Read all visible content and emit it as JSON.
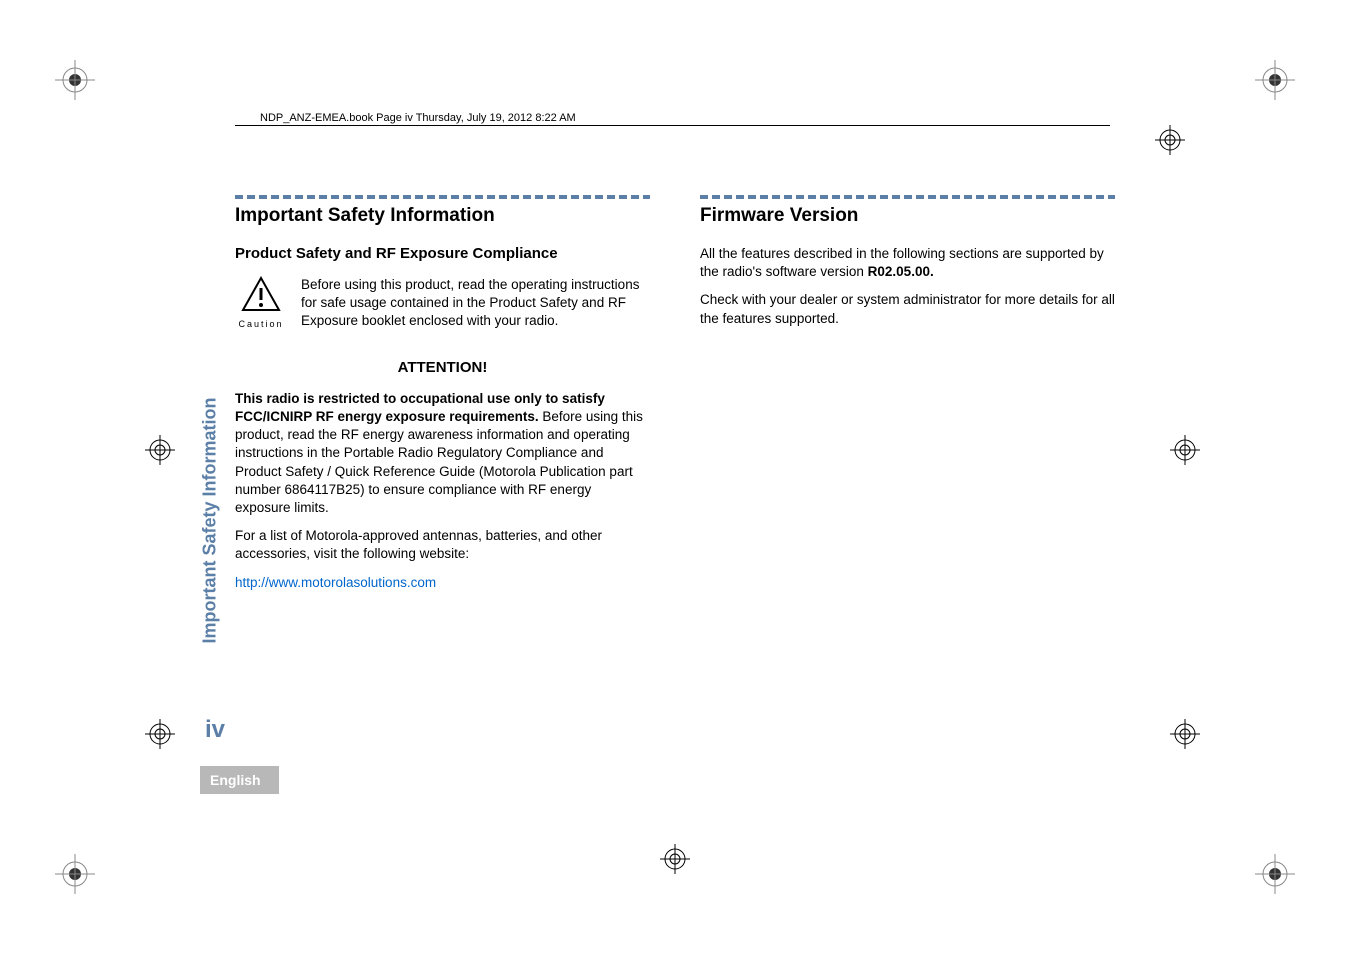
{
  "header": {
    "filename": "NDP_ANZ-EMEA.book  Page iv  Thursday, July 19, 2012  8:22 AM"
  },
  "left_column": {
    "heading": "Important Safety Information",
    "subheading": "Product Safety and RF Exposure Compliance",
    "caution_label": "Caution",
    "caution_text": "Before using this product, read the operating instructions for safe usage contained in the Product Safety and RF Exposure booklet enclosed with your radio.",
    "attention_heading": "ATTENTION!",
    "attention_bold": "This radio is restricted to occupational use only to satisfy FCC/ICNIRP RF energy exposure requirements.",
    "attention_rest": " Before using this product, read the RF energy awareness information and operating instructions in the Portable Radio Regulatory Compliance and Product Safety / Quick Reference Guide (Motorola Publication part number 6864117B25) to ensure compliance with RF energy exposure limits.",
    "accessories_text": "For a list of Motorola-approved antennas, batteries, and other accessories, visit the following website:",
    "link_text": "http://www.motorolasolutions.com"
  },
  "right_column": {
    "heading": "Firmware Version",
    "para1_a": "All the features described in the following sections are supported by the radio's software version ",
    "para1_b": "R02.05.00.",
    "para2": "Check with your dealer or system administrator for more details for all the features supported."
  },
  "side": {
    "tab_text": "Important Safety Information",
    "page_number": "iv",
    "language": "English"
  }
}
